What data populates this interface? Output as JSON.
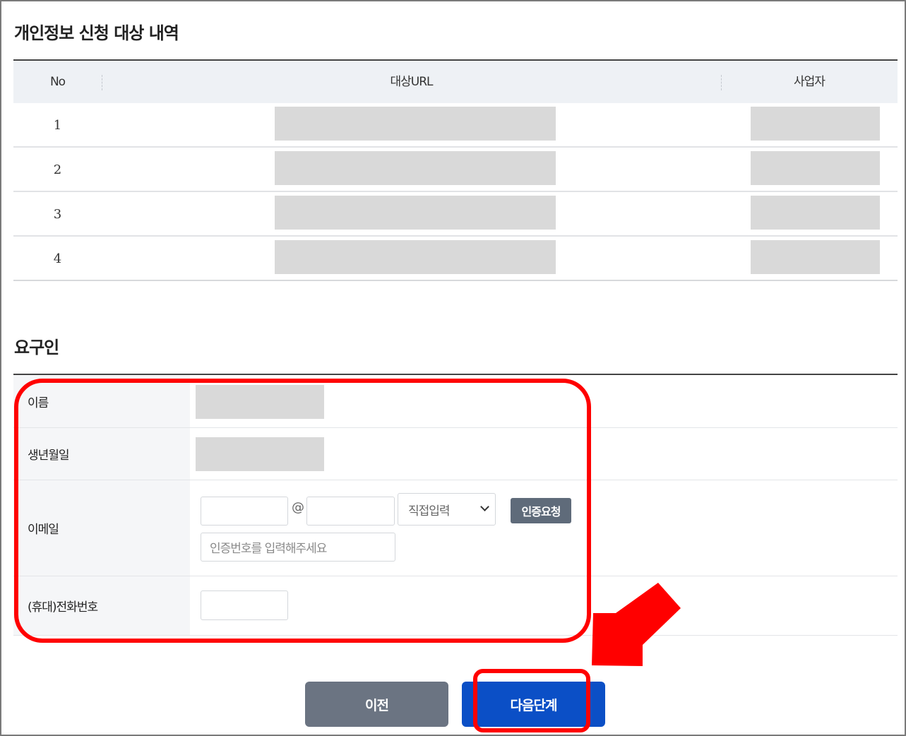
{
  "section_target": {
    "title": "개인정보 신청 대상 내역",
    "columns": [
      "No",
      "대상URL",
      "사업자"
    ],
    "rows": [
      {
        "no": "1"
      },
      {
        "no": "2"
      },
      {
        "no": "3"
      },
      {
        "no": "4"
      }
    ]
  },
  "section_requester": {
    "title": "요구인",
    "fields": {
      "name_label": "이름",
      "birth_label": "생년월일",
      "email_label": "이메일",
      "email_at": "@",
      "email_domain_select": "직접입력",
      "auth_request_button": "인증요청",
      "auth_code_placeholder": "인증번호를 입력해주세요",
      "phone_label": "(휴대)전화번호"
    }
  },
  "buttons": {
    "prev": "이전",
    "next": "다음단계"
  },
  "colors": {
    "annotation": "#ff0000",
    "next_button": "#0b4fc6",
    "prev_button": "#6b7482",
    "auth_button": "#5f6b7a"
  }
}
